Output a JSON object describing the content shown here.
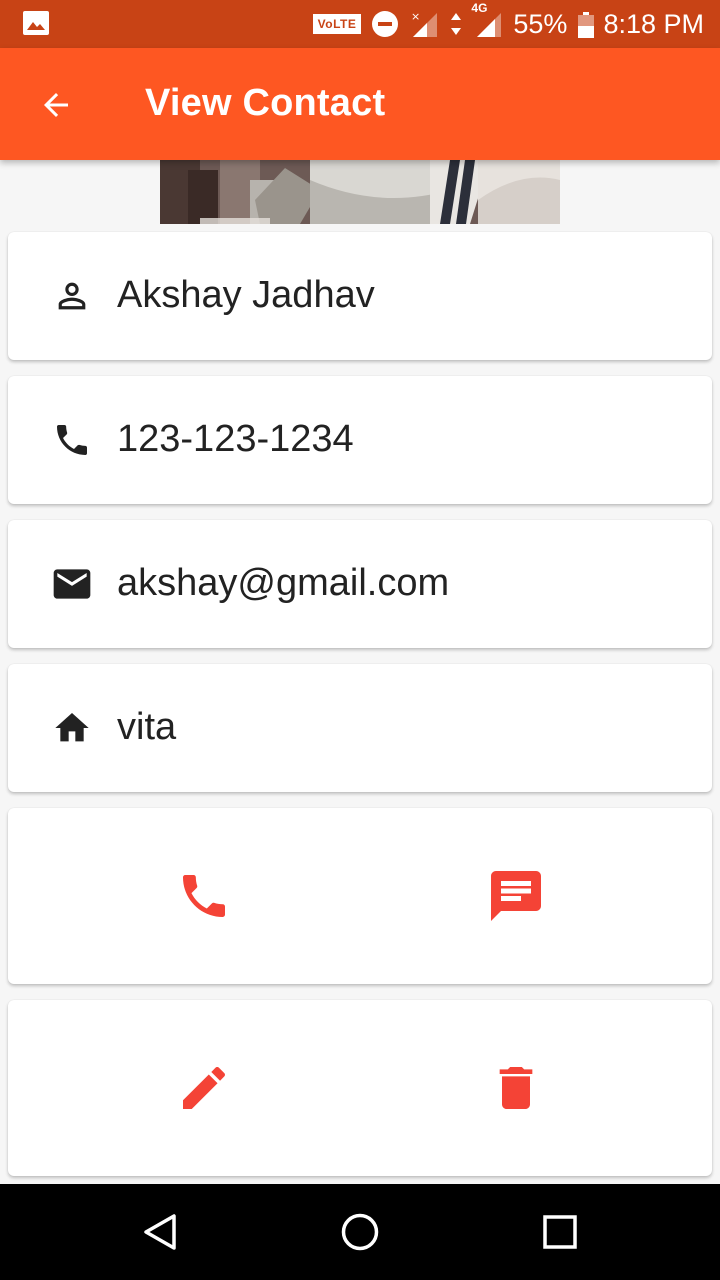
{
  "status_bar": {
    "volte": "VoLTE",
    "network": "4G",
    "battery": "55%",
    "time": "8:18 PM",
    "icons": [
      "image-icon",
      "volte-icon",
      "do-not-disturb-icon",
      "signal-icon",
      "data-arrows-icon",
      "battery-icon"
    ]
  },
  "app_bar": {
    "title": "View Contact",
    "back_icon": "arrow-back-icon",
    "background": "#fe5722"
  },
  "contact": {
    "name": "Akshay Jadhav",
    "phone": "123-123-1234",
    "email": "akshay@gmail.com",
    "address": "vita"
  },
  "field_icons": {
    "name": "person-icon",
    "phone": "phone-icon",
    "email": "email-icon",
    "address": "home-icon"
  },
  "actions": {
    "call": "phone-icon",
    "message": "message-icon",
    "edit": "edit-pencil-icon",
    "delete": "delete-trash-icon",
    "accent": "#f44336"
  },
  "nav_bar": {
    "icons": [
      "nav-back-icon",
      "nav-home-icon",
      "nav-recents-icon"
    ]
  }
}
